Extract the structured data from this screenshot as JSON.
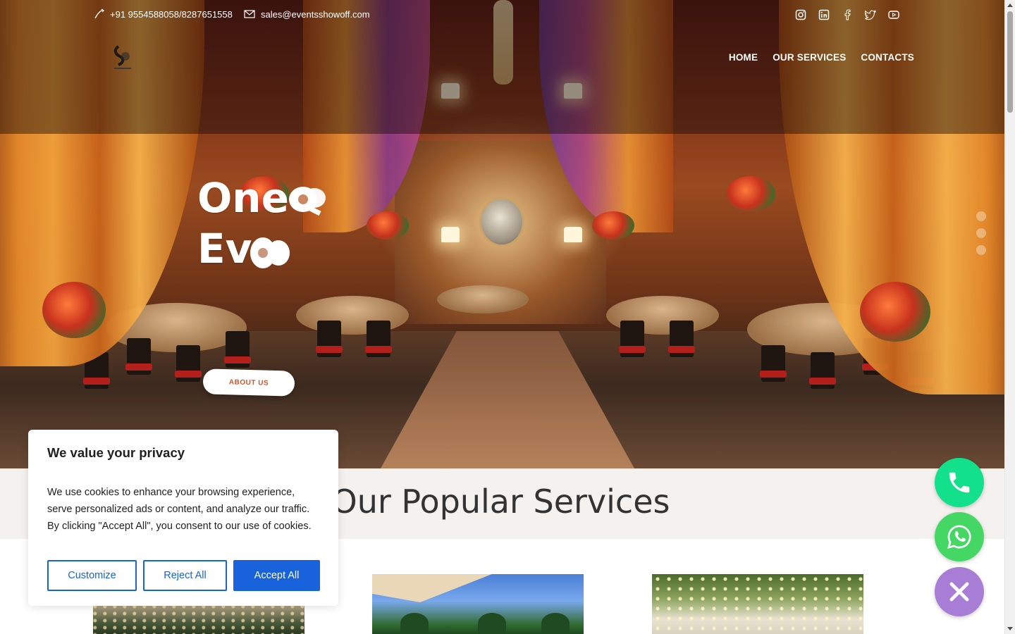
{
  "topbar": {
    "phone": "+91 9554588058/8287651558",
    "email": "sales@eventsshowoff.com",
    "socials": [
      "instagram-icon",
      "linkedin-icon",
      "facebook-icon",
      "twitter-icon",
      "youtube-icon"
    ]
  },
  "nav": {
    "items": [
      {
        "label": "HOME"
      },
      {
        "label": "OUR SERVICES"
      },
      {
        "label": "CONTACTS"
      }
    ]
  },
  "hero": {
    "title_line1": "One",
    "title_line2": "Ev",
    "button_label": "ABOUT US",
    "slide_count": 3
  },
  "services": {
    "heading": "Our Popular Services"
  },
  "cookie": {
    "title": "We value your privacy",
    "body": "We use cookies to enhance your browsing experience, serve personalized ads or content, and analyze our traffic. By clicking \"Accept All\", you consent to our use of cookies.",
    "customize": "Customize",
    "reject": "Reject All",
    "accept": "Accept All"
  },
  "colors": {
    "accent_blue": "#1863dc",
    "phone_fab": "#13e08a",
    "whatsapp_fab": "#44d764",
    "close_fab": "#a77dd6",
    "about_text": "#d0532a"
  }
}
